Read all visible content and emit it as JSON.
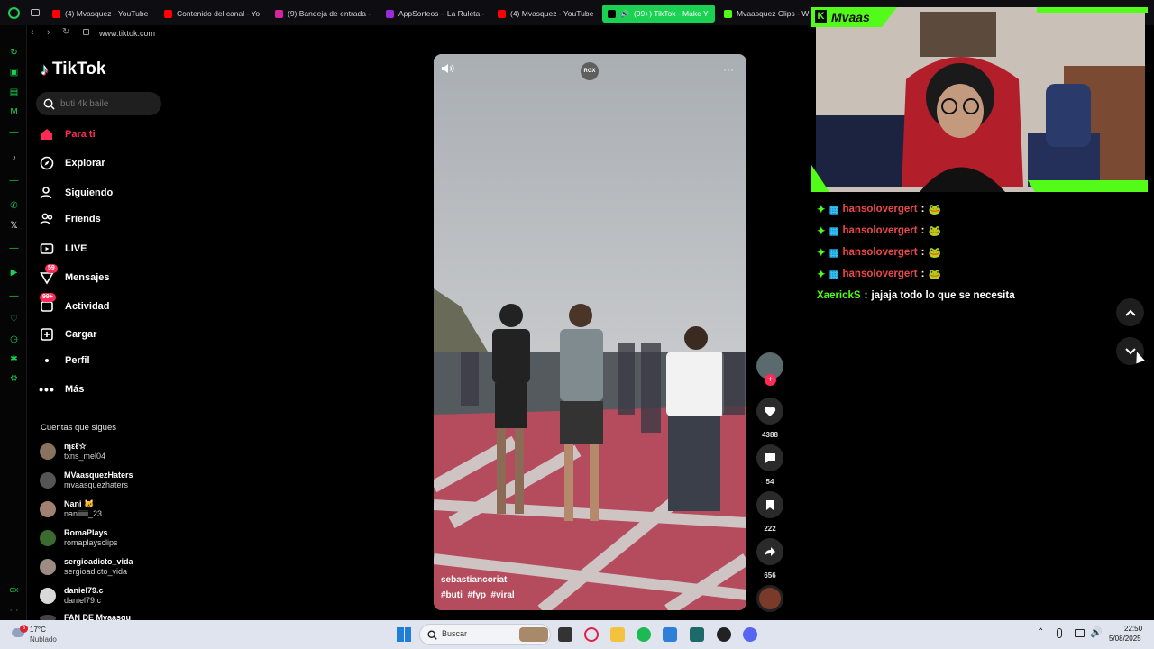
{
  "browser": {
    "tabs": [
      {
        "label": "(4) Mvasquez - YouTube",
        "color": "#ff0000"
      },
      {
        "label": "Contenido del canal - Yo",
        "color": "#ff0000"
      },
      {
        "label": "(9) Bandeja de entrada -",
        "color": "#d6249f"
      },
      {
        "label": "AppSorteos – La Ruleta -",
        "color": "#9b2bd8"
      },
      {
        "label": "(4) Mvasquez - YouTube",
        "color": "#ff0000"
      },
      {
        "label": "(99+) TikTok - Make Y",
        "color": "#000000"
      },
      {
        "label": "Mvaasquez Clips - W",
        "color": "#53fc18"
      }
    ],
    "url": "www.tiktok.com"
  },
  "tiktok": {
    "logo": "TikTok",
    "search_placeholder": "buti 4k baile",
    "nav": [
      {
        "label": "Para ti",
        "icon": "home-icon"
      },
      {
        "label": "Explorar",
        "icon": "compass-icon"
      },
      {
        "label": "Siguiendo",
        "icon": "following-icon"
      },
      {
        "label": "Friends",
        "icon": "friends-icon"
      },
      {
        "label": "LIVE",
        "icon": "live-icon"
      },
      {
        "label": "Mensajes",
        "icon": "messages-icon",
        "badge": "59"
      },
      {
        "label": "Actividad",
        "icon": "activity-icon",
        "badge": "99+"
      },
      {
        "label": "Cargar",
        "icon": "upload-icon"
      },
      {
        "label": "Perfil",
        "icon": "profile-icon"
      },
      {
        "label": "Más",
        "icon": "more-icon"
      }
    ],
    "following_title": "Cuentas que sigues",
    "accounts": [
      {
        "name": "ɱεℓ☆",
        "handle": "txns_mel04"
      },
      {
        "name": "MVaasquezHaters",
        "handle": "mvaasquezhaters"
      },
      {
        "name": "Nani 🐱",
        "handle": "naniiiiii_23"
      },
      {
        "name": "RomaPlays",
        "handle": "romaplaysclips"
      },
      {
        "name": "sergioadicto_vida",
        "handle": "sergioadicto_vida"
      },
      {
        "name": "daniel79.c",
        "handle": "daniel79.c"
      },
      {
        "name": "FAN DE Mvaasqu",
        "handle": ""
      }
    ],
    "video": {
      "watermark": "RGX",
      "author": "sebastiancoriat",
      "hashtags": "#buti  #fyp  #viral",
      "likes": "4388",
      "comments": "54",
      "saves": "222",
      "shares": "656"
    }
  },
  "stream": {
    "channel": "Mvaas",
    "chat": [
      {
        "user": "hansolovergert",
        "text": "",
        "green": false
      },
      {
        "user": "hansolovergert",
        "text": "",
        "green": false
      },
      {
        "user": "hansolovergert",
        "text": "",
        "green": false
      },
      {
        "user": "hansolovergert",
        "text": "",
        "green": false
      },
      {
        "user": "XaerickS",
        "text": "jajaja todo lo que se necesita",
        "green": true
      }
    ]
  },
  "taskbar": {
    "temp": "17°C",
    "weather": "Nublado",
    "weather_badge": "3",
    "search": "Buscar",
    "time": "22:50",
    "date": "5/08/2025"
  }
}
